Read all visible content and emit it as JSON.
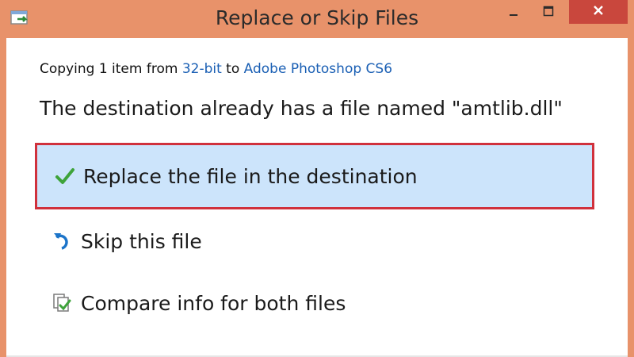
{
  "window": {
    "title": "Replace or Skip Files",
    "accent_color": "#e8926a",
    "close_color": "#c9473d"
  },
  "copy_info": {
    "prefix": "Copying 1 item from ",
    "source": "32-bit",
    "middle": " to ",
    "destination": "Adobe Photoshop CS6"
  },
  "message": "The destination already has a file named \"amtlib.dll\"",
  "options": [
    {
      "icon": "green-checkmark-icon",
      "label": "Replace the file in the destination",
      "selected": true
    },
    {
      "icon": "skip-arrow-icon",
      "label": "Skip this file",
      "selected": false
    },
    {
      "icon": "compare-files-icon",
      "label": "Compare info for both files",
      "selected": false
    }
  ],
  "highlight_color": "#d0313c"
}
